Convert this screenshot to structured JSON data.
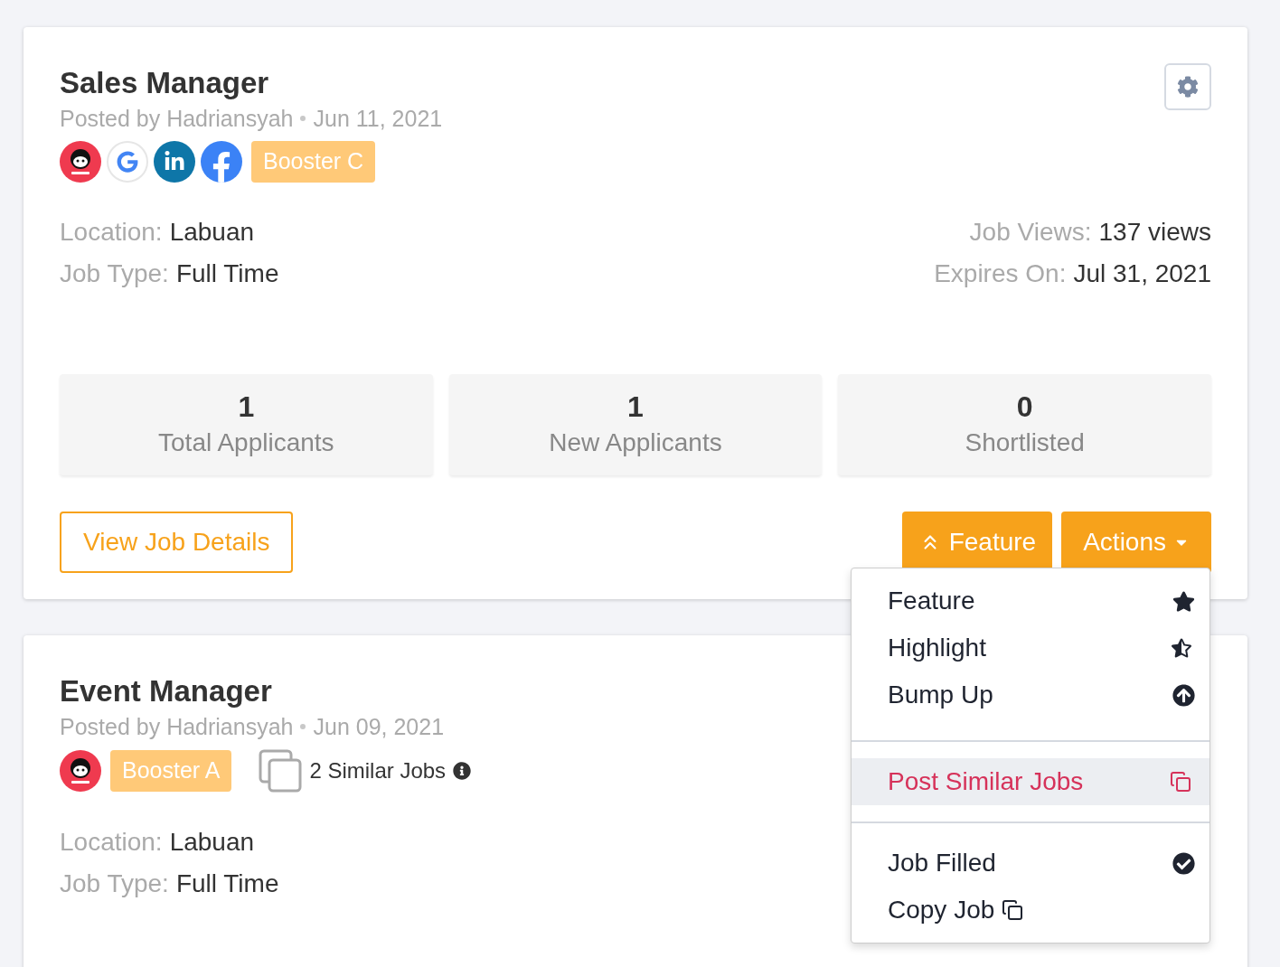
{
  "jobs": [
    {
      "title": "Sales Manager",
      "posted_by": "Posted by Hadriansyah",
      "date": "Jun 11, 2021",
      "sources": [
        {
          "kind": "mascot"
        },
        {
          "kind": "google"
        },
        {
          "kind": "linkedin"
        },
        {
          "kind": "facebook"
        }
      ],
      "badge": "Booster C",
      "details_left": [
        {
          "label": "Location:",
          "value": "Labuan"
        },
        {
          "label": "Job Type:",
          "value": "Full Time"
        }
      ],
      "details_right": [
        {
          "label": "Job Views:",
          "value": "137 views"
        },
        {
          "label": "Expires On:",
          "value": "Jul 31, 2021"
        }
      ],
      "stats": [
        {
          "value": "1",
          "label": "Total Applicants"
        },
        {
          "value": "1",
          "label": "New Applicants"
        },
        {
          "value": "0",
          "label": "Shortlisted"
        }
      ],
      "view_button": "View Job Details",
      "feature_button": "Feature",
      "actions_button": "Actions"
    },
    {
      "title": "Event Manager",
      "posted_by": "Posted by Hadriansyah",
      "date": "Jun 09, 2021",
      "sources": [
        {
          "kind": "mascot"
        }
      ],
      "badge": "Booster A",
      "similar": "2 Similar Jobs",
      "details_left": [
        {
          "label": "Location:",
          "value": "Labuan"
        },
        {
          "label": "Job Type:",
          "value": "Full Time"
        }
      ]
    }
  ],
  "actions_menu": {
    "groups": [
      [
        {
          "label": "Feature",
          "kind": "star",
          "selected": false
        },
        {
          "label": "Highlight",
          "kind": "half-star",
          "selected": false
        },
        {
          "label": "Bump Up",
          "kind": "up",
          "selected": false
        }
      ],
      [
        {
          "label": "Post Similar Jobs",
          "kind": "copy",
          "selected": true
        }
      ],
      [
        {
          "label": "Job Filled",
          "kind": "check",
          "selected": false
        },
        {
          "label": "Copy Job",
          "kind": "inline-copy",
          "selected": false
        }
      ]
    ]
  }
}
